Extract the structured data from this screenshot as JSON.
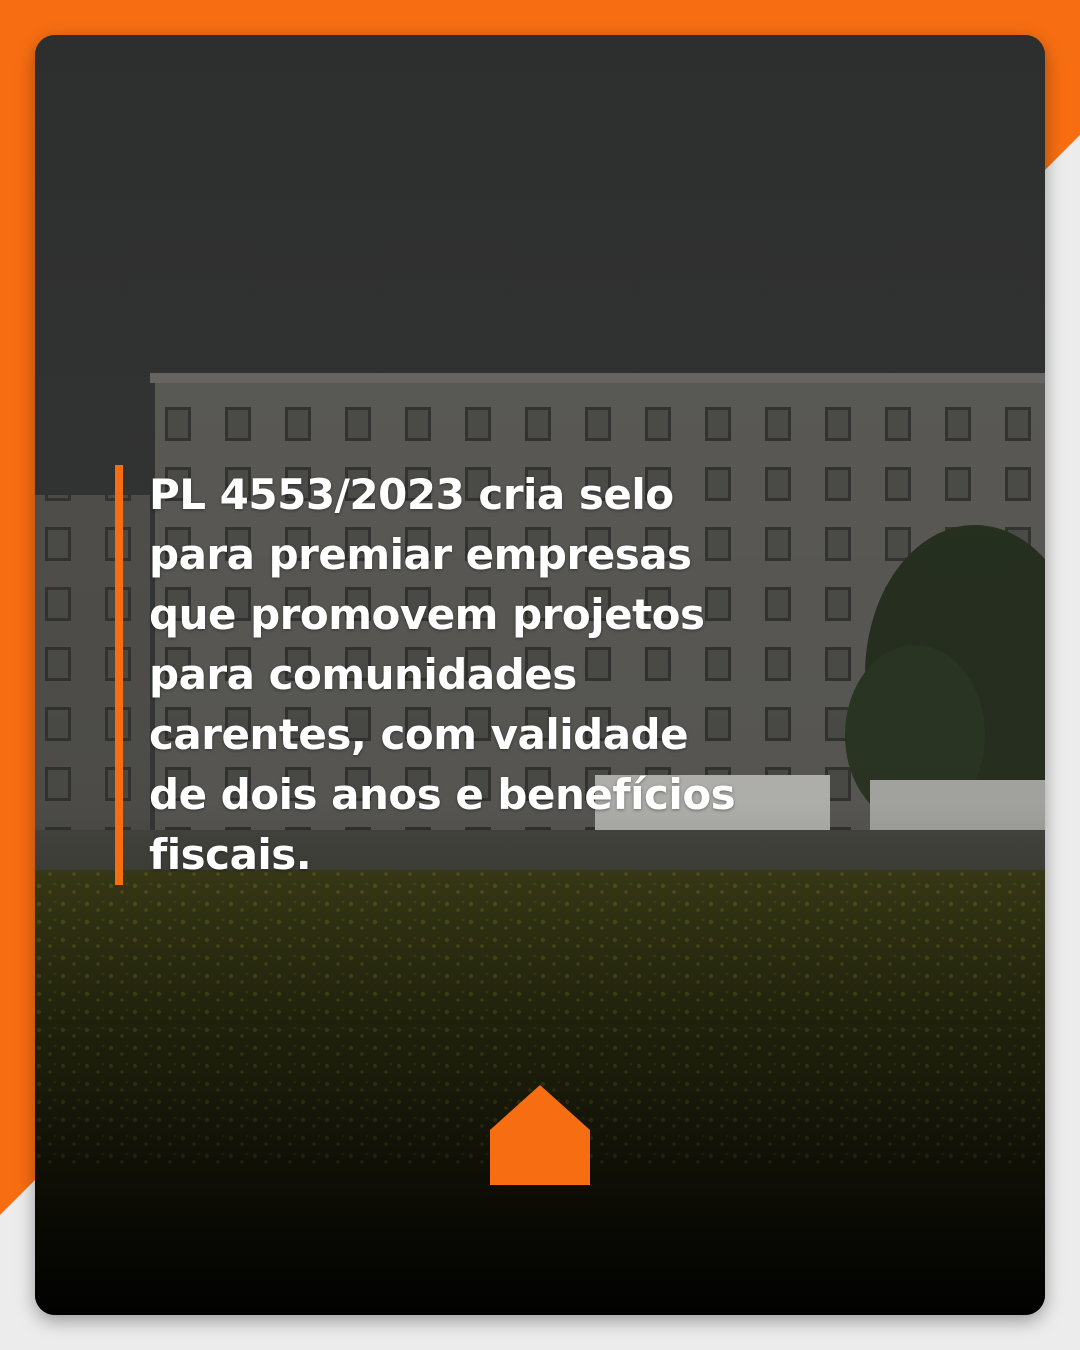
{
  "colors": {
    "accent": "#f76e12",
    "page_background": "#ececec",
    "text": "#ffffff"
  },
  "post": {
    "headline": "PL 4553/2023 cria selo para premiar empresas que promovem projetos para comunidades carentes, com validade de dois anos e benefícios fiscais."
  },
  "logo": {
    "icon": "house-icon"
  }
}
